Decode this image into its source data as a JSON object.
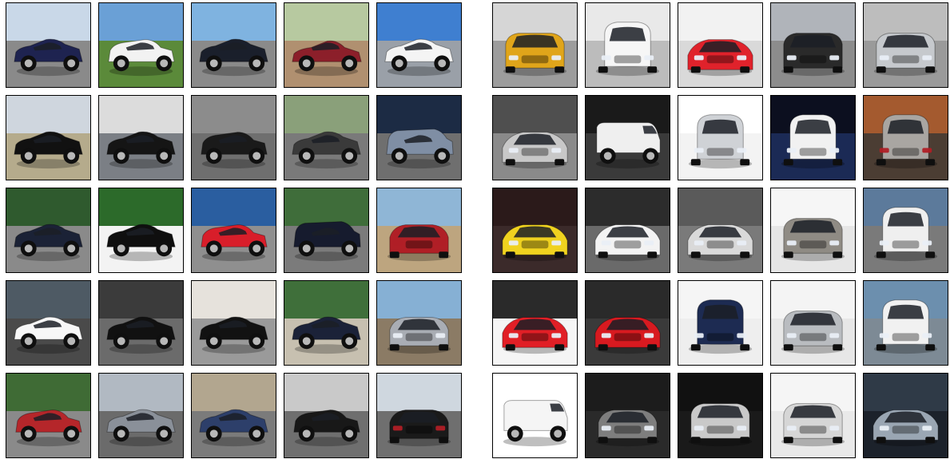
{
  "panels": [
    {
      "id": "left",
      "tiles": [
        {
          "subject": "sedan",
          "view": "side",
          "body": "#1e2350",
          "bg": "#c9d8e8",
          "ground": "#8a8a8a"
        },
        {
          "subject": "hatchback",
          "view": "side",
          "body": "#f2f2f2",
          "bg": "#6aa0d6",
          "ground": "#5b8a3a"
        },
        {
          "subject": "sedan",
          "view": "side",
          "body": "#1a1f2b",
          "bg": "#7fb3e0",
          "ground": "#8a8a8a"
        },
        {
          "subject": "coupe",
          "view": "side",
          "body": "#8c1f2a",
          "bg": "#b7c9a0",
          "ground": "#b09070"
        },
        {
          "subject": "sedan",
          "view": "side",
          "body": "#f4f4f4",
          "bg": "#3f7fd0",
          "ground": "#9aa0a8"
        },
        {
          "subject": "sedan",
          "view": "side",
          "body": "#111111",
          "bg": "#cfd6de",
          "ground": "#b5ab8c"
        },
        {
          "subject": "sedan",
          "view": "side",
          "body": "#151515",
          "bg": "#dcdcdc",
          "ground": "#7b7f85"
        },
        {
          "subject": "hatchback",
          "view": "side",
          "body": "#1a1a1a",
          "bg": "#8c8c8c",
          "ground": "#6f6f6f"
        },
        {
          "subject": "sedan",
          "view": "side",
          "body": "#3a3a3a",
          "bg": "#8aa07a",
          "ground": "#7a7a7a"
        },
        {
          "subject": "suv",
          "view": "side",
          "body": "#7f8ea4",
          "bg": "#1c2b44",
          "ground": "#6f6f6f"
        },
        {
          "subject": "sedan",
          "view": "side",
          "body": "#1b2236",
          "bg": "#2f5a2e",
          "ground": "#8a8a8a"
        },
        {
          "subject": "sedan",
          "view": "side",
          "body": "#0f0f0f",
          "bg": "#2c6a2a",
          "ground": "#f3f3f3"
        },
        {
          "subject": "hatchback",
          "view": "side",
          "body": "#d81e2a",
          "bg": "#2a5ea0",
          "ground": "#8f8f8f"
        },
        {
          "subject": "suv",
          "view": "side",
          "body": "#161b2e",
          "bg": "#3f6d3a",
          "ground": "#7b7b7b"
        },
        {
          "subject": "hatchback",
          "view": "rear",
          "body": "#b01f26",
          "bg": "#8fb6d6",
          "ground": "#bda57f"
        },
        {
          "subject": "sedan",
          "view": "side",
          "body": "#f7f7f7",
          "bg": "#4e5a64",
          "ground": "#4a4a4a"
        },
        {
          "subject": "sedan",
          "view": "side",
          "body": "#111111",
          "bg": "#3b3b3b",
          "ground": "#6b6b6b"
        },
        {
          "subject": "sedan",
          "view": "side",
          "body": "#121212",
          "bg": "#e6e2dc",
          "ground": "#9a9a9a"
        },
        {
          "subject": "sedan",
          "view": "side",
          "body": "#1b2238",
          "bg": "#3f6f3a",
          "ground": "#c7c0b0"
        },
        {
          "subject": "hatchback",
          "view": "front",
          "body": "#a9adb4",
          "bg": "#86b0d4",
          "ground": "#8b7b65"
        },
        {
          "subject": "hatchback",
          "view": "side",
          "body": "#b5262a",
          "bg": "#3f6b35",
          "ground": "#8a8a8a"
        },
        {
          "subject": "sedan",
          "view": "side",
          "body": "#8a9099",
          "bg": "#b1b9c2",
          "ground": "#6b6b6b"
        },
        {
          "subject": "sedan",
          "view": "side",
          "body": "#2d3f6a",
          "bg": "#b2a68f",
          "ground": "#7b7b7b"
        },
        {
          "subject": "hatchback",
          "view": "side",
          "body": "#181818",
          "bg": "#c9c9c9",
          "ground": "#6f6f6f"
        },
        {
          "subject": "sedan",
          "view": "rear",
          "body": "#1a1a1a",
          "bg": "#cfd7df",
          "ground": "#6f6f6f"
        }
      ]
    },
    {
      "id": "right",
      "tiles": [
        {
          "subject": "suv",
          "view": "front",
          "body": "#e0a51a",
          "bg": "#d6d6d6",
          "ground": "#9c9c9c"
        },
        {
          "subject": "van",
          "view": "front",
          "body": "#f6f6f6",
          "bg": "#e9e9e9",
          "ground": "#bcbcbc"
        },
        {
          "subject": "coupe",
          "view": "front",
          "body": "#e0222b",
          "bg": "#f2f2f2",
          "ground": "#d9d9d9"
        },
        {
          "subject": "suv",
          "view": "front",
          "body": "#2a2a2a",
          "bg": "#b0b4ba",
          "ground": "#8c8c8c"
        },
        {
          "subject": "suv",
          "view": "front",
          "body": "#c6c9cd",
          "bg": "#bdbdbd",
          "ground": "#9a9a9a"
        },
        {
          "subject": "coupe",
          "view": "front",
          "body": "#c8c8c8",
          "bg": "#4f4f4f",
          "ground": "#8a8a8a"
        },
        {
          "subject": "van",
          "view": "side",
          "body": "#efefef",
          "bg": "#1a1a1a",
          "ground": "#3a3a3a"
        },
        {
          "subject": "van",
          "view": "front",
          "body": "#cfd2d6",
          "bg": "#ffffff",
          "ground": "#f3f3f3"
        },
        {
          "subject": "van",
          "view": "front",
          "body": "#f1f1f1",
          "bg": "#0c0f1f",
          "ground": "#1b2a55"
        },
        {
          "subject": "van",
          "view": "rear",
          "body": "#a9a6a2",
          "bg": "#a45a2f",
          "ground": "#4b3d33"
        },
        {
          "subject": "coupe",
          "view": "front",
          "body": "#f0d21f",
          "bg": "#2b1a1a",
          "ground": "#3b2a2a"
        },
        {
          "subject": "coupe",
          "view": "front",
          "body": "#f3f3f3",
          "bg": "#2c2c2c",
          "ground": "#6a6a6a"
        },
        {
          "subject": "coupe",
          "view": "front",
          "body": "#d9d9d9",
          "bg": "#5a5a5a",
          "ground": "#7a7a7a"
        },
        {
          "subject": "suv",
          "view": "front",
          "body": "#8f8b84",
          "bg": "#f6f6f6",
          "ground": "#e6e6e6"
        },
        {
          "subject": "van",
          "view": "front",
          "body": "#efefef",
          "bg": "#5c7a9b",
          "ground": "#7a7a7a"
        },
        {
          "subject": "coupe",
          "view": "front",
          "body": "#e11f26",
          "bg": "#2a2a2a",
          "ground": "#f5f5f5"
        },
        {
          "subject": "coupe",
          "view": "front",
          "body": "#d81a20",
          "bg": "#2a2a2a",
          "ground": "#3a3a3a"
        },
        {
          "subject": "van",
          "view": "front",
          "body": "#1d2b52",
          "bg": "#f5f5f5",
          "ground": "#eeeeee"
        },
        {
          "subject": "suv",
          "view": "front",
          "body": "#b9bcc0",
          "bg": "#f4f4f4",
          "ground": "#e7e7e7"
        },
        {
          "subject": "van",
          "view": "front",
          "body": "#f1f1f1",
          "bg": "#6c8fae",
          "ground": "#7d8a95"
        },
        {
          "subject": "van",
          "view": "side",
          "body": "#f5f5f5",
          "bg": "#ffffff",
          "ground": "#ffffff"
        },
        {
          "subject": "sedan",
          "view": "front",
          "body": "#7e7e7e",
          "bg": "#1c1c1c",
          "ground": "#2a2a2a"
        },
        {
          "subject": "suv",
          "view": "front",
          "body": "#c9c9c9",
          "bg": "#111111",
          "ground": "#1a1a1a"
        },
        {
          "subject": "suv",
          "view": "front",
          "body": "#d6d6d6",
          "bg": "#f5f5f5",
          "ground": "#e9e9e9"
        },
        {
          "subject": "coupe",
          "view": "front",
          "body": "#9aa6b3",
          "bg": "#2f3a47",
          "ground": "#1c222b"
        }
      ]
    }
  ]
}
